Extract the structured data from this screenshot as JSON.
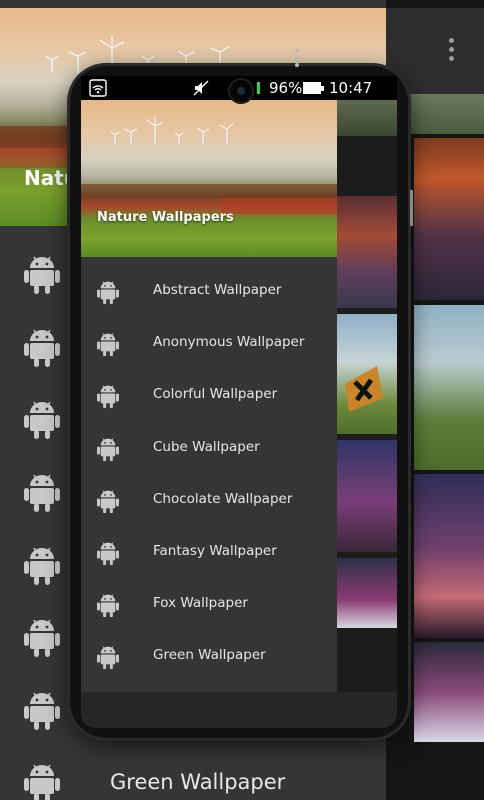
{
  "colors": {
    "drawer_bg": "#353535",
    "status_bar_bg": "#000000",
    "battery_indicator": "#3fd13f",
    "text_primary": "#e6e6e6",
    "android_icon": "#c8c8c8"
  },
  "status_bar": {
    "battery_percent": "96%",
    "time": "10:47 PM",
    "icons": [
      "wifi-icon",
      "mute-icon",
      "battery-icon"
    ]
  },
  "background": {
    "header_title": "Natu",
    "last_visible_item": "Green Wallpaper",
    "icon": "android-icon"
  },
  "drawer": {
    "header_title": "Nature Wallpapers",
    "items": [
      {
        "label": "Abstract Wallpaper",
        "icon": "android-icon"
      },
      {
        "label": "Anonymous Wallpaper",
        "icon": "android-icon"
      },
      {
        "label": "Colorful Wallpaper",
        "icon": "android-icon"
      },
      {
        "label": "Cube Wallpaper",
        "icon": "android-icon"
      },
      {
        "label": "Chocolate Wallpaper",
        "icon": "android-icon"
      },
      {
        "label": "Fantasy Wallpaper",
        "icon": "android-icon"
      },
      {
        "label": "Fox Wallpaper",
        "icon": "android-icon"
      },
      {
        "label": "Green Wallpaper",
        "icon": "android-icon"
      }
    ]
  },
  "app_bar": {
    "overflow_icon": "more-vert-icon"
  }
}
